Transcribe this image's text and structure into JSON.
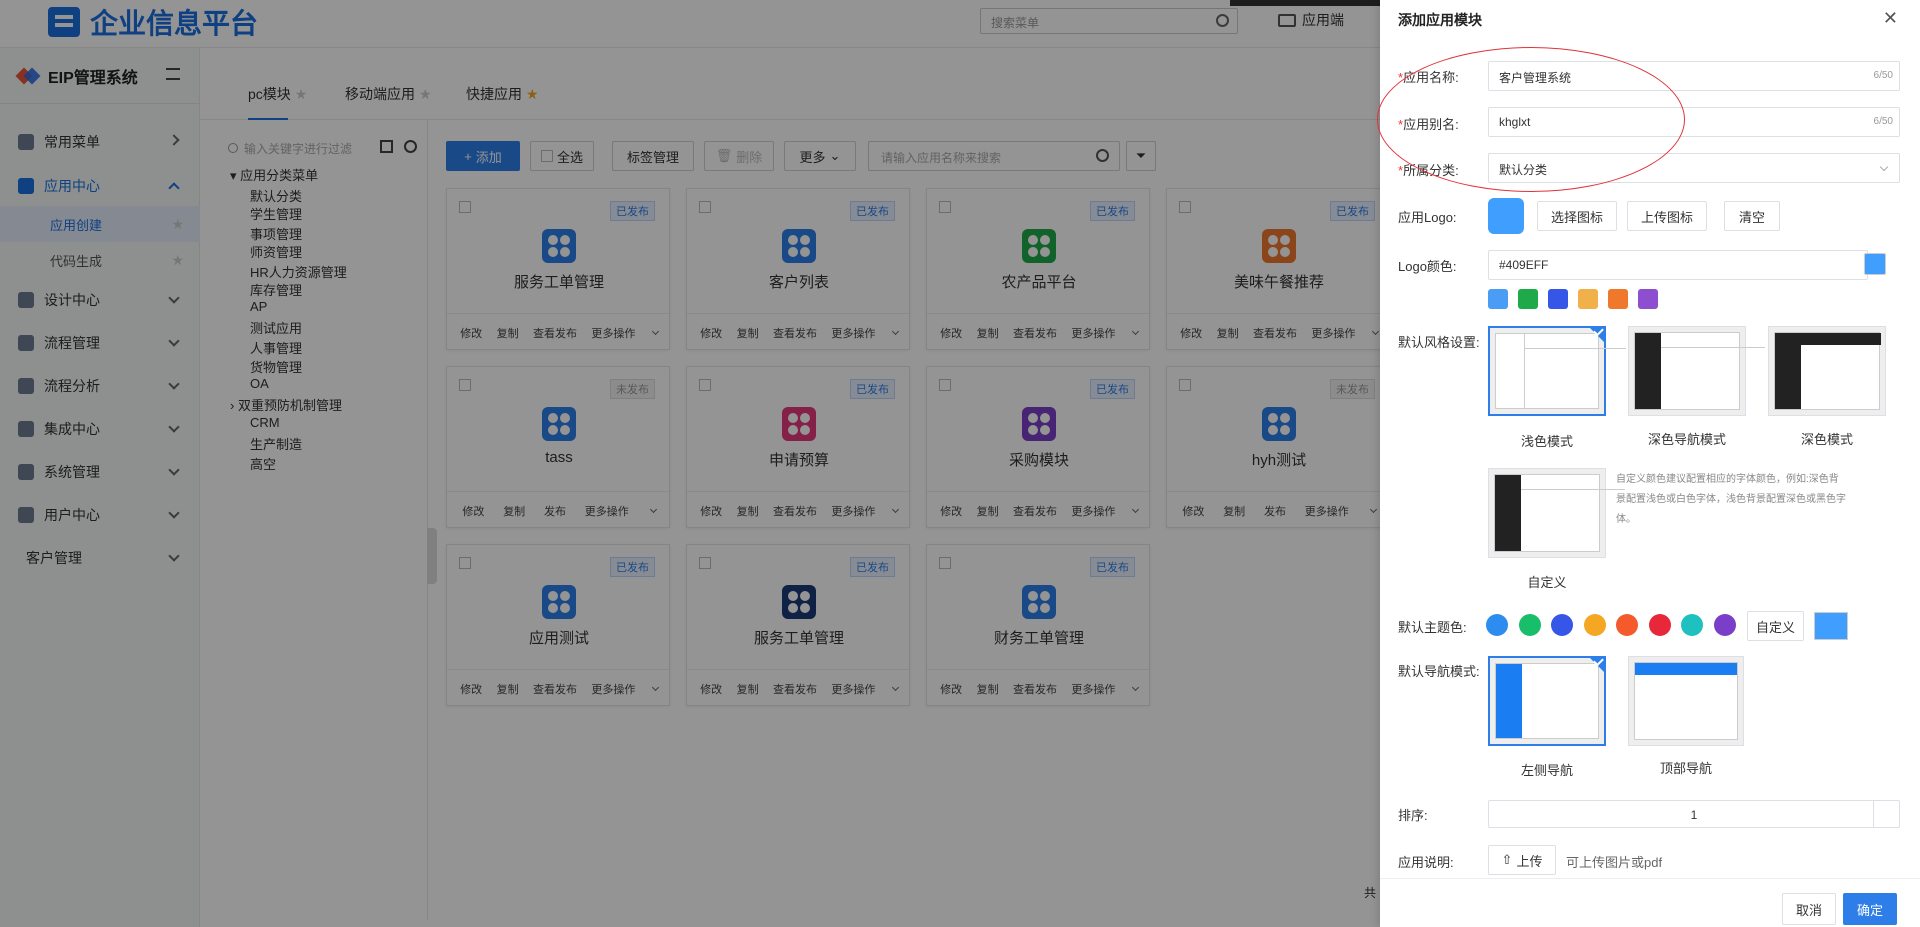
{
  "header": {
    "title": "企业信息平台",
    "search_placeholder": "搜索菜单",
    "app_side": "应用端"
  },
  "sidebar": {
    "title": "EIP管理系统",
    "items": [
      {
        "label": "常用菜单"
      },
      {
        "label": "应用中心"
      },
      {
        "label": "设计中心"
      },
      {
        "label": "流程管理"
      },
      {
        "label": "流程分析"
      },
      {
        "label": "集成中心"
      },
      {
        "label": "系统管理"
      },
      {
        "label": "用户中心"
      },
      {
        "label": "客户管理"
      }
    ],
    "subitems": [
      {
        "label": "应用创建"
      },
      {
        "label": "代码生成"
      }
    ]
  },
  "tabs": [
    {
      "label": "pc模块"
    },
    {
      "label": "移动端应用"
    },
    {
      "label": "快捷应用"
    }
  ],
  "tree": {
    "placeholder": "输入关键字进行过滤",
    "root": "应用分类菜单",
    "nodes": [
      "默认分类",
      "学生管理",
      "事项管理",
      "师资管理",
      "HR人力资源管理",
      "库存管理",
      "AP",
      "测试应用",
      "人事管理",
      "货物管理",
      "OA",
      "双重预防机制管理",
      "CRM",
      "生产制造",
      "高空"
    ]
  },
  "toolbar": {
    "add": "添加",
    "select_all": "全选",
    "tag": "标签管理",
    "delete": "删除",
    "more": "更多",
    "search_placeholder": "请输入应用名称来搜索"
  },
  "cards": [
    {
      "name": "服务工单管理",
      "status": "已发布",
      "color": "#2d7ee8",
      "actions": [
        "修改",
        "复制",
        "查看发布",
        "更多操作"
      ]
    },
    {
      "name": "客户列表",
      "status": "已发布",
      "color": "#2d7ee8",
      "actions": [
        "修改",
        "复制",
        "查看发布",
        "更多操作"
      ]
    },
    {
      "name": "农产品平台",
      "status": "已发布",
      "color": "#1faa4a",
      "actions": [
        "修改",
        "复制",
        "查看发布",
        "更多操作"
      ]
    },
    {
      "name": "美味午餐推荐",
      "status": "已发布",
      "color": "#f0782d",
      "actions": [
        "修改",
        "复制",
        "查看发布",
        "更多操作"
      ]
    },
    {
      "name": "tass",
      "status": "未发布",
      "color": "#2d7ee8",
      "actions": [
        "修改",
        "复制",
        "发布",
        "更多操作"
      ]
    },
    {
      "name": "申请预算",
      "status": "已发布",
      "color": "#e6387c",
      "actions": [
        "修改",
        "复制",
        "查看发布",
        "更多操作"
      ]
    },
    {
      "name": "采购模块",
      "status": "已发布",
      "color": "#7a3ec8",
      "actions": [
        "修改",
        "复制",
        "查看发布",
        "更多操作"
      ]
    },
    {
      "name": "hyh测试",
      "status": "未发布",
      "color": "#2d7ee8",
      "actions": [
        "修改",
        "复制",
        "发布",
        "更多操作"
      ]
    },
    {
      "name": "应用测试",
      "status": "已发布",
      "color": "#2d7ee8",
      "actions": [
        "修改",
        "复制",
        "查看发布",
        "更多操作"
      ]
    },
    {
      "name": "服务工单管理",
      "status": "已发布",
      "color": "#1b3a78",
      "actions": [
        "修改",
        "复制",
        "查看发布",
        "更多操作"
      ]
    },
    {
      "name": "财务工单管理",
      "status": "已发布",
      "color": "#2d7ee8",
      "actions": [
        "修改",
        "复制",
        "查看发布",
        "更多操作"
      ]
    }
  ],
  "pager_text": "共",
  "drawer": {
    "title": "添加应用模块",
    "app_name_label": "应用名称:",
    "app_name_value": "客户管理系统",
    "app_name_count": "6/50",
    "alias_label": "应用别名:",
    "alias_value": "khglxt",
    "alias_count": "6/50",
    "category_label": "所属分类:",
    "category_value": "默认分类",
    "logo_label": "应用Logo:",
    "choose_icon": "选择图标",
    "upload_icon": "上传图标",
    "clear": "清空",
    "logo_color_label": "Logo颜色:",
    "logo_color_value": "#409EFF",
    "logo_swatches": [
      "#4a9cf5",
      "#1faa4a",
      "#3656e8",
      "#f2b04a",
      "#f0782d",
      "#8d4fd0"
    ],
    "style_label": "默认风格设置:",
    "styles": [
      {
        "label": "浅色模式"
      },
      {
        "label": "深色导航模式"
      },
      {
        "label": "深色模式"
      },
      {
        "label": "自定义"
      }
    ],
    "custom_note": "自定义颜色建议配置相应的字体颜色，例如:深色背景配置浅色或白色字体，浅色背景配置深色或黑色字体。",
    "theme_label": "默认主题色:",
    "theme_dots": [
      "#2d8cf0",
      "#19be6b",
      "#3656e8",
      "#f5a623",
      "#f55a2d",
      "#e8283a",
      "#1fc0c0",
      "#7a3ec8"
    ],
    "theme_custom": "自定义",
    "nav_label": "默认导航模式:",
    "navs": [
      {
        "label": "左侧导航"
      },
      {
        "label": "顶部导航"
      }
    ],
    "order_label": "排序:",
    "order_value": "1",
    "desc_label": "应用说明:",
    "upload": "上传",
    "upload_hint": "可上传图片或pdf",
    "cancel": "取消",
    "confirm": "确定"
  }
}
